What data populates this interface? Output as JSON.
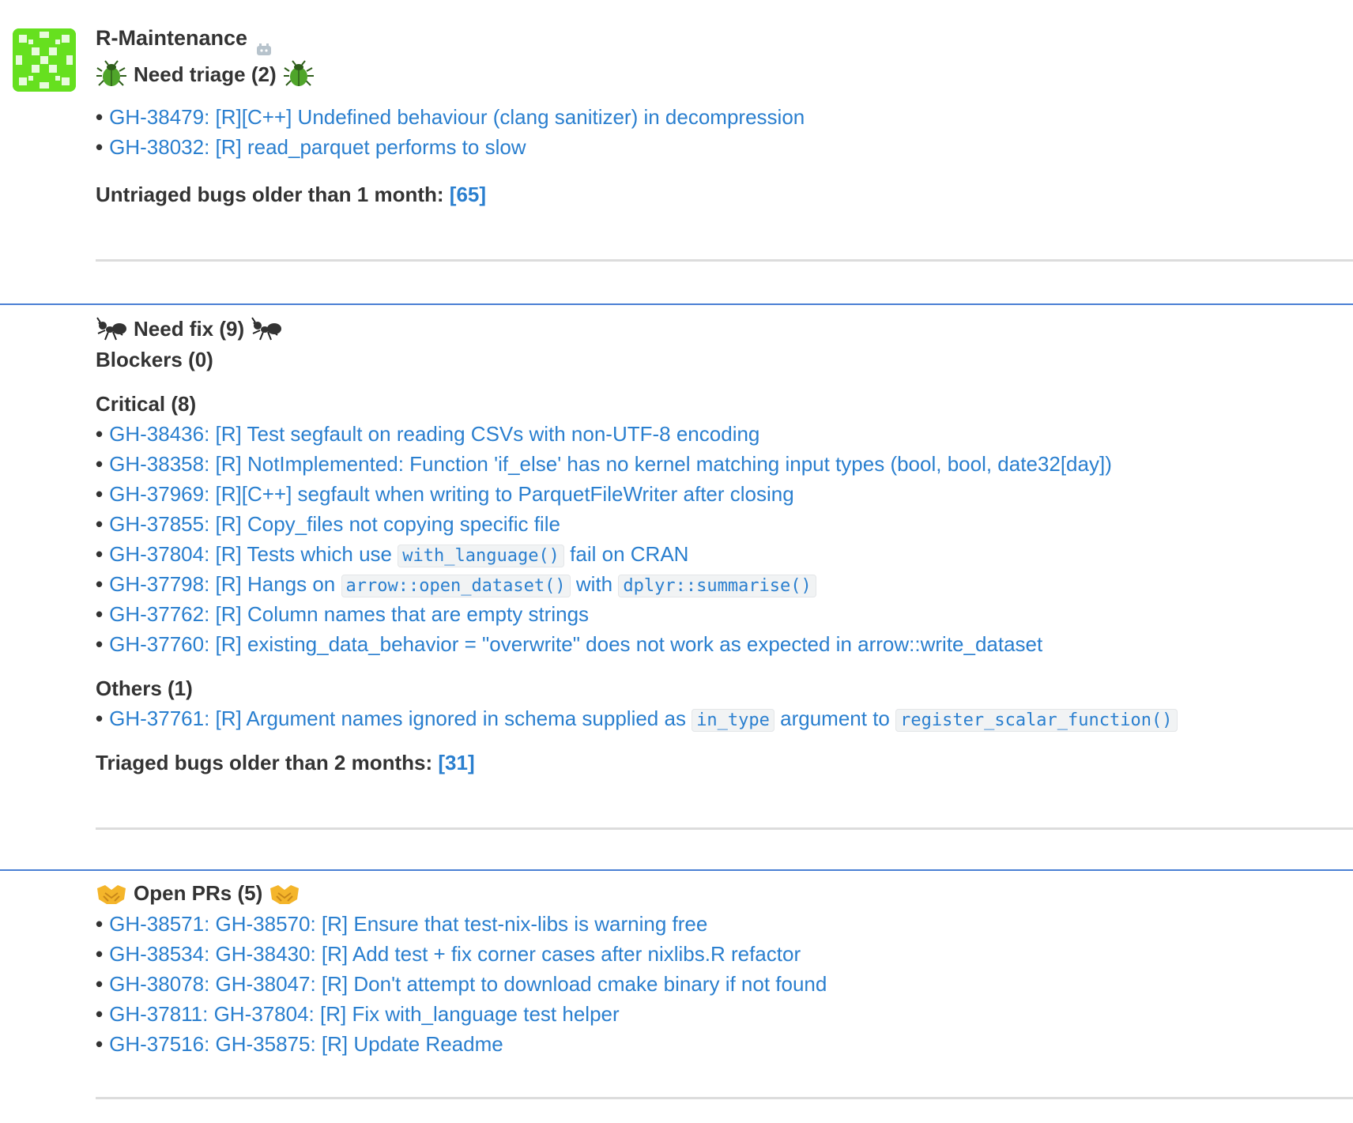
{
  "sender": {
    "name": "R-Maintenance",
    "bot_icon": "bot-icon"
  },
  "triage": {
    "title": "Need triage (2)",
    "icon": "beetle-icon",
    "items": [
      {
        "label": "GH-38479: [R][C++] Undefined behaviour (clang sanitizer) in decompression"
      },
      {
        "label": "GH-38032: [R] read_parquet performs to slow"
      }
    ],
    "older_label": "Untriaged bugs older than 1 month:",
    "older_count": "[65]"
  },
  "fix": {
    "title": "Need fix (9)",
    "icon": "ant-icon",
    "blockers": "Blockers (0)",
    "critical": "Critical (8)",
    "critical_items": [
      {
        "a": "GH-38436: [R] Test segfault on reading CSVs with non-UTF-8 encoding"
      },
      {
        "a": "GH-38358: [R] NotImplemented: Function 'if_else' has no kernel matching input types (bool, bool, date32[day])"
      },
      {
        "a": "GH-37969: [R][C++] segfault when writing to ParquetFileWriter after closing"
      },
      {
        "a": "GH-37855: [R] Copy_files not copying specific file"
      },
      {
        "a": "GH-37804: [R] Tests which use",
        "code1": "with_language()",
        "b": "fail on CRAN"
      },
      {
        "a": "GH-37798: [R] Hangs on",
        "code1": "arrow::open_dataset()",
        "b": "with",
        "code2": "dplyr::summarise()"
      },
      {
        "a": "GH-37762: [R] Column names that are empty strings"
      },
      {
        "a": "GH-37760: [R] existing_data_behavior = \"overwrite\" does not work as expected in arrow::write_dataset"
      }
    ],
    "others": "Others (1)",
    "other_items": [
      {
        "a": "GH-37761: [R] Argument names ignored in schema supplied as",
        "code1": "in_type",
        "b": "argument to",
        "code2": "register_scalar_function()"
      }
    ],
    "older_label": "Triaged bugs older than 2 months:",
    "older_count": "[31]"
  },
  "prs": {
    "title": "Open PRs (5)",
    "icon": "handshake-icon",
    "items": [
      {
        "label": "GH-38571: GH-38570: [R] Ensure that test-nix-libs is warning free"
      },
      {
        "label": "GH-38534: GH-38430: [R] Add test + fix corner cases after nixlibs.R refactor"
      },
      {
        "label": "GH-38078: GH-38047: [R] Don't attempt to download cmake binary if not found"
      },
      {
        "label": "GH-37811: GH-37804: [R] Fix with_language test helper"
      },
      {
        "label": "GH-37516: GH-35875: [R] Update Readme"
      }
    ]
  },
  "colors": {
    "link": "#2a7fcf",
    "avatar": "#66e01f",
    "highlight_border": "#4a7fd4"
  }
}
